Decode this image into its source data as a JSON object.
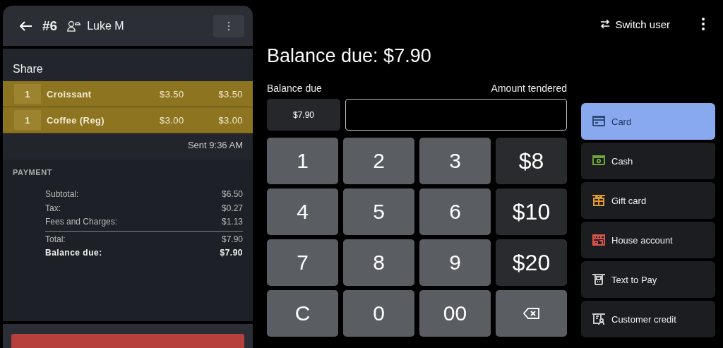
{
  "header": {
    "order": "#6",
    "customer": "Luke M"
  },
  "share": {
    "title": "Share",
    "items": [
      {
        "qty": "1",
        "name": "Croissant",
        "price": "$3.50",
        "total": "$3.50"
      },
      {
        "qty": "1",
        "name": "Coffee (Reg)",
        "price": "$3.00",
        "total": "$3.00"
      }
    ],
    "sent": "Sent 9:36 AM"
  },
  "payment": {
    "title": "PAYMENT",
    "lines": [
      {
        "kind": "normal",
        "label": "Subtotal:",
        "value": "$6.50"
      },
      {
        "kind": "normal",
        "label": "Tax:",
        "value": "$0.27"
      },
      {
        "kind": "normal",
        "label": "Fees and Charges:",
        "value": "$1.13"
      },
      {
        "kind": "total",
        "label": "Total:",
        "value": "$7.90"
      },
      {
        "kind": "balance",
        "label": "Balance due:",
        "value": "$7.90"
      }
    ]
  },
  "switch_user": "Switch user",
  "heading": "Balance due: $7.90",
  "balance": {
    "label": "Balance due",
    "value": "$7.90"
  },
  "tendered": {
    "label": "Amount tendered"
  },
  "keys": [
    {
      "kind": "digit",
      "label": "1"
    },
    {
      "kind": "digit",
      "label": "2"
    },
    {
      "kind": "digit",
      "label": "3"
    },
    {
      "kind": "quick",
      "label": "$8"
    },
    {
      "kind": "digit",
      "label": "4"
    },
    {
      "kind": "digit",
      "label": "5"
    },
    {
      "kind": "digit",
      "label": "6"
    },
    {
      "kind": "quick",
      "label": "$10"
    },
    {
      "kind": "digit",
      "label": "7"
    },
    {
      "kind": "digit",
      "label": "8"
    },
    {
      "kind": "digit",
      "label": "9"
    },
    {
      "kind": "quick",
      "label": "$20"
    },
    {
      "kind": "digit",
      "label": "C"
    },
    {
      "kind": "digit",
      "label": "0"
    },
    {
      "kind": "digit",
      "label": "00"
    },
    {
      "kind": "backspace"
    }
  ],
  "methods": [
    {
      "kind": "card",
      "label": "Card",
      "selected": true,
      "color": "#2c4a78"
    },
    {
      "kind": "cash",
      "label": "Cash",
      "selected": false,
      "color": "#6fa53a"
    },
    {
      "kind": "gift",
      "label": "Gift card",
      "selected": false,
      "color": "#e39a2a"
    },
    {
      "kind": "house",
      "label": "House account",
      "selected": false,
      "color": "#d9534a"
    },
    {
      "kind": "phone",
      "label": "Text to Pay",
      "selected": false,
      "color": "#c8c8c8"
    },
    {
      "kind": "credit",
      "label": "Customer credit",
      "selected": false,
      "color": "#c8c8c8"
    }
  ]
}
